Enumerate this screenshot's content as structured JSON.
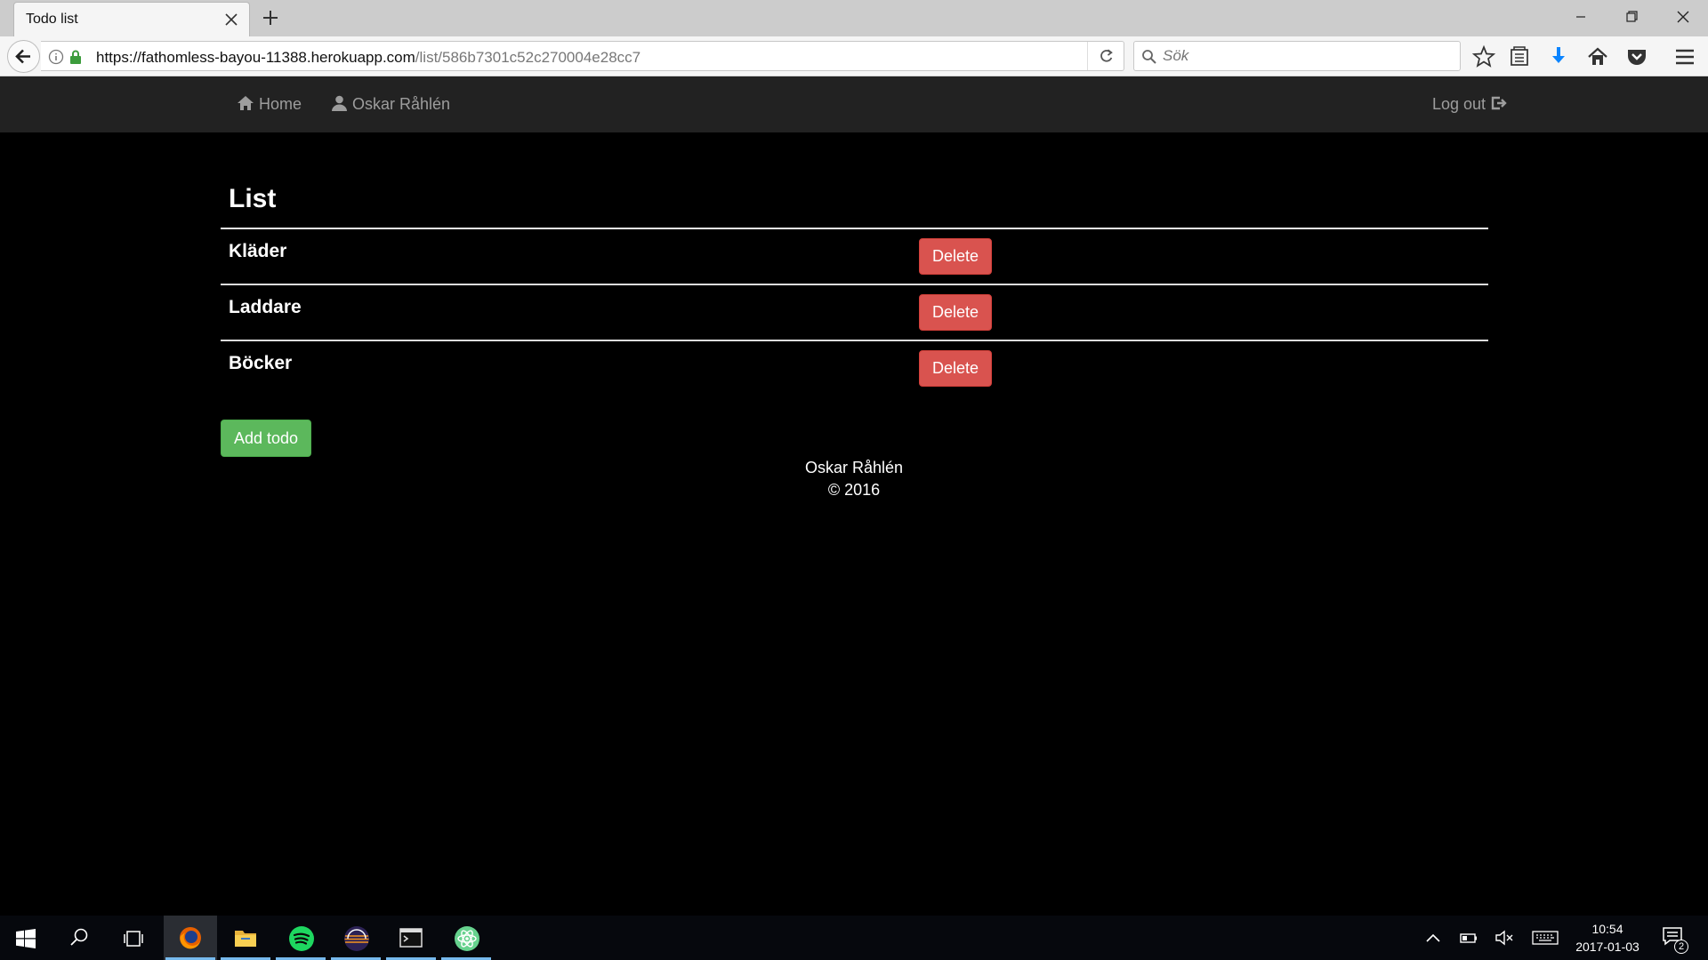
{
  "browser": {
    "tab_title": "Todo list",
    "url_host": "https://fathomless-bayou-11388.herokuapp.com",
    "url_path": "/list/586b7301c52c270004e28cc7",
    "search_placeholder": "Sök"
  },
  "site_nav": {
    "home_label": "Home",
    "user_label": "Oskar Råhlén",
    "logout_label": "Log out"
  },
  "main": {
    "title": "List",
    "todos": [
      {
        "name": "Kläder",
        "delete_label": "Delete"
      },
      {
        "name": "Laddare",
        "delete_label": "Delete"
      },
      {
        "name": "Böcker",
        "delete_label": "Delete"
      }
    ],
    "add_label": "Add todo"
  },
  "footer": {
    "name": "Oskar Råhlén",
    "copyright": "© 2016"
  },
  "taskbar": {
    "time": "10:54",
    "date": "2017-01-03",
    "notification_count": "2",
    "apps": [
      "firefox-icon",
      "file-explorer-icon",
      "spotify-icon",
      "eclipse-icon",
      "terminal-icon",
      "atom-icon"
    ]
  },
  "colors": {
    "delete": "#d9534f",
    "add": "#5cb85c",
    "navbar": "#222222"
  }
}
